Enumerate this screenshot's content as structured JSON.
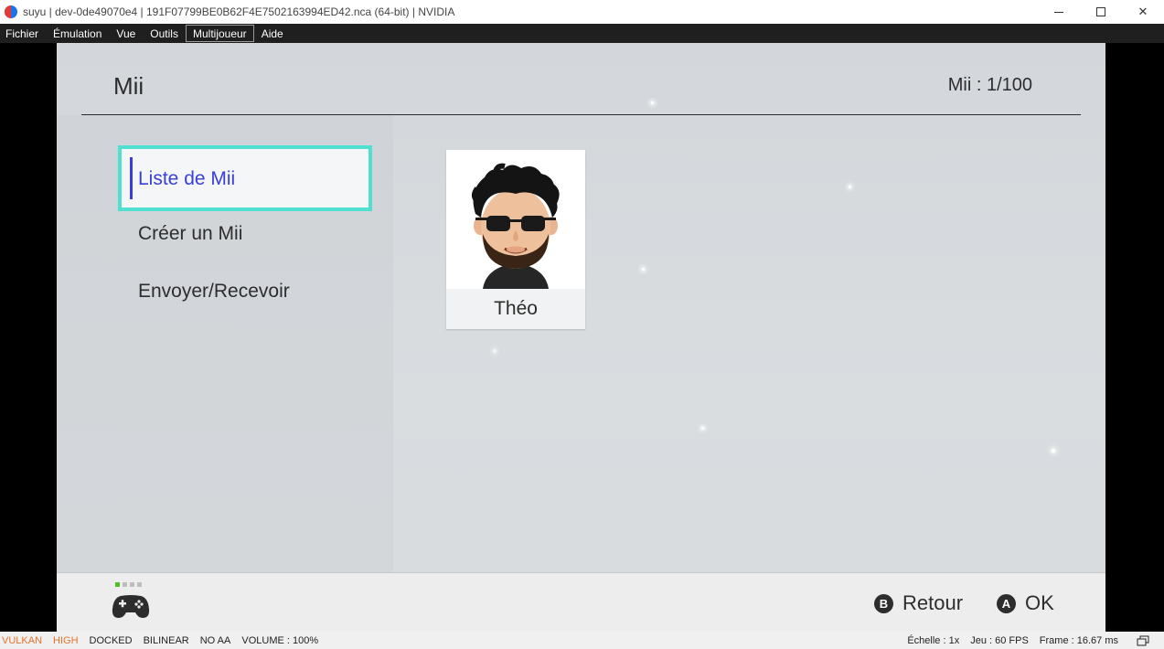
{
  "window": {
    "title": "suyu | dev-0de49070e4 | 191F07799BE0B62F4E7502163994ED42.nca (64-bit) | NVIDIA",
    "minimize": "—",
    "maximize": "☐",
    "close": "✕"
  },
  "menu": {
    "items": [
      "Fichier",
      "Émulation",
      "Vue",
      "Outils",
      "Multijoueur",
      "Aide"
    ],
    "active": "Multijoueur"
  },
  "screen": {
    "title": "Mii",
    "count": "Mii : 1/100",
    "nav": [
      "Liste de Mii",
      "Créer un Mii",
      "Envoyer/Recevoir"
    ],
    "mii_name": "Théo",
    "footer": {
      "back_button": "B",
      "back_label": "Retour",
      "ok_button": "A",
      "ok_label": "OK"
    },
    "colors": {
      "selection_border": "#4fe0cf",
      "selection_text": "#3a3ed8",
      "player_indicator": "#4fc31d"
    }
  },
  "status": {
    "api": "VULKAN",
    "accuracy": "HIGH",
    "mode": "DOCKED",
    "filter": "BILINEAR",
    "aa": "NO AA",
    "volume": "VOLUME : 100%",
    "scale": "Échelle : 1x",
    "fps": "Jeu : 60 FPS",
    "frame": "Frame : 16.67 ms"
  },
  "icons": {
    "app": "suyu-logo-icon",
    "controller": "controller-icon",
    "fullscreen": "window-restore-icon"
  }
}
